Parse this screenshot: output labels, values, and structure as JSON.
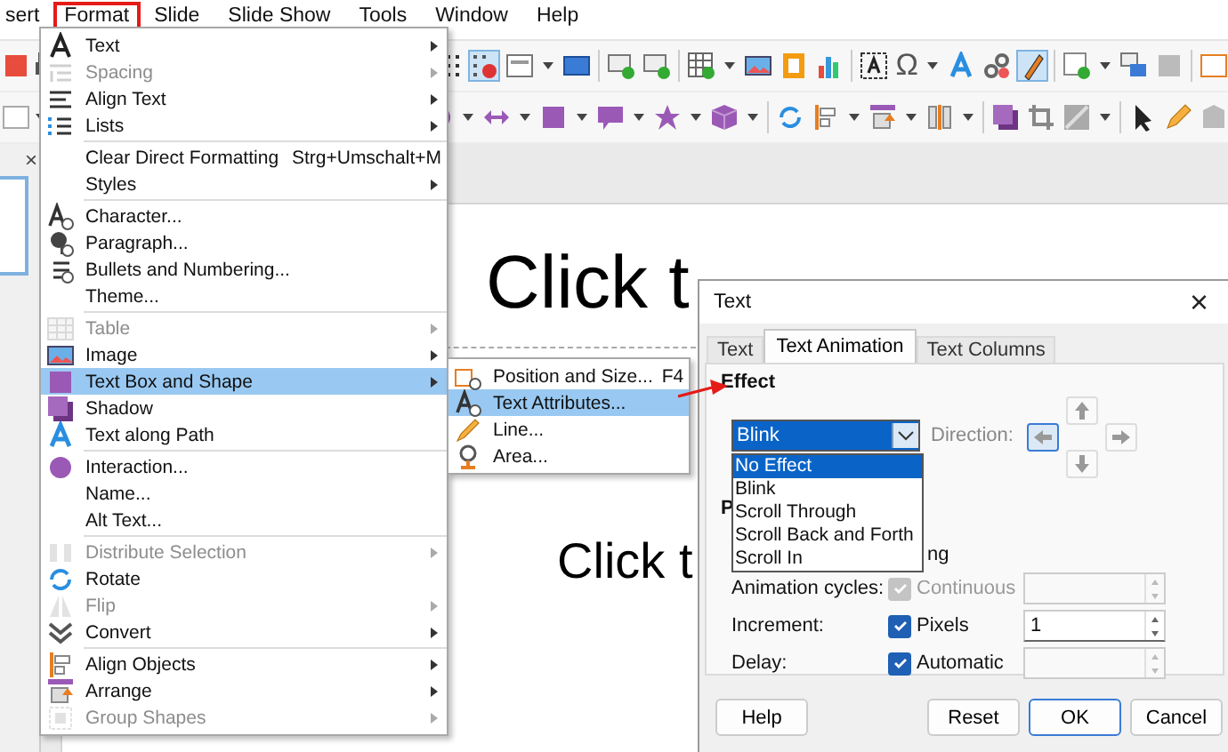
{
  "menubar": [
    {
      "label": "sert",
      "selected": false
    },
    {
      "label": "Format",
      "selected": true
    },
    {
      "label": "Slide",
      "selected": false
    },
    {
      "label": "Slide Show",
      "selected": false
    },
    {
      "label": "Tools",
      "selected": false
    },
    {
      "label": "Window",
      "selected": false
    },
    {
      "label": "Help",
      "selected": false
    }
  ],
  "toolbar_symbol": "Ω",
  "left_panel": {
    "close": "×"
  },
  "slide": {
    "title": "Click t",
    "subtitle": "Click t"
  },
  "format_menu": [
    {
      "kind": "item",
      "label": "Text",
      "submenu": true,
      "disabled": false,
      "selected": false
    },
    {
      "kind": "item",
      "label": "Spacing",
      "submenu": true,
      "disabled": true,
      "selected": false
    },
    {
      "kind": "item",
      "label": "Align Text",
      "submenu": true,
      "disabled": false,
      "selected": false
    },
    {
      "kind": "item",
      "label": "Lists",
      "submenu": true,
      "disabled": false,
      "selected": false
    },
    {
      "kind": "separator"
    },
    {
      "kind": "item",
      "label": "Clear Direct Formatting",
      "shortcut": "Strg+Umschalt+M",
      "submenu": false,
      "disabled": false,
      "selected": false
    },
    {
      "kind": "item",
      "label": "Styles",
      "submenu": true,
      "disabled": false,
      "selected": false
    },
    {
      "kind": "separator"
    },
    {
      "kind": "item",
      "label": "Character...",
      "submenu": false,
      "disabled": false,
      "selected": false
    },
    {
      "kind": "item",
      "label": "Paragraph...",
      "submenu": false,
      "disabled": false,
      "selected": false
    },
    {
      "kind": "item",
      "label": "Bullets and Numbering...",
      "submenu": false,
      "disabled": false,
      "selected": false
    },
    {
      "kind": "item",
      "label": "Theme...",
      "submenu": false,
      "disabled": false,
      "selected": false
    },
    {
      "kind": "separator"
    },
    {
      "kind": "item",
      "label": "Table",
      "submenu": true,
      "disabled": true,
      "selected": false
    },
    {
      "kind": "item",
      "label": "Image",
      "submenu": true,
      "disabled": false,
      "selected": false
    },
    {
      "kind": "item",
      "label": "Text Box and Shape",
      "submenu": true,
      "disabled": false,
      "selected": true
    },
    {
      "kind": "item",
      "label": "Shadow",
      "submenu": false,
      "disabled": false,
      "selected": false
    },
    {
      "kind": "item",
      "label": "Text along Path",
      "submenu": false,
      "disabled": false,
      "selected": false
    },
    {
      "kind": "separator"
    },
    {
      "kind": "item",
      "label": "Interaction...",
      "submenu": false,
      "disabled": false,
      "selected": false
    },
    {
      "kind": "item",
      "label": "Name...",
      "submenu": false,
      "disabled": false,
      "selected": false
    },
    {
      "kind": "item",
      "label": "Alt Text...",
      "submenu": false,
      "disabled": false,
      "selected": false
    },
    {
      "kind": "separator"
    },
    {
      "kind": "item",
      "label": "Distribute Selection",
      "submenu": true,
      "disabled": true,
      "selected": false
    },
    {
      "kind": "item",
      "label": "Rotate",
      "submenu": false,
      "disabled": false,
      "selected": false
    },
    {
      "kind": "item",
      "label": "Flip",
      "submenu": true,
      "disabled": true,
      "selected": false
    },
    {
      "kind": "item",
      "label": "Convert",
      "submenu": true,
      "disabled": false,
      "selected": false
    },
    {
      "kind": "separator"
    },
    {
      "kind": "item",
      "label": "Align Objects",
      "submenu": true,
      "disabled": false,
      "selected": false
    },
    {
      "kind": "item",
      "label": "Arrange",
      "submenu": true,
      "disabled": false,
      "selected": false
    },
    {
      "kind": "item",
      "label": "Group Shapes",
      "submenu": true,
      "disabled": true,
      "selected": false
    }
  ],
  "shape_submenu": [
    {
      "label": "Position and Size...",
      "shortcut": "F4",
      "selected": false
    },
    {
      "label": "Text Attributes...",
      "selected": true
    },
    {
      "label": "Line...",
      "selected": false
    },
    {
      "label": "Area...",
      "selected": false
    }
  ],
  "dialog": {
    "title": "Text",
    "close": "×",
    "tabs": [
      {
        "label": "Text",
        "selected": false
      },
      {
        "label": "Text Animation",
        "selected": true
      },
      {
        "label": "Text Columns",
        "selected": false
      }
    ],
    "effect_heading": "Effect",
    "effect_select": {
      "value": "Blink",
      "options": [
        {
          "label": "No Effect",
          "highlighted": true
        },
        {
          "label": "Blink",
          "highlighted": false
        },
        {
          "label": "Scroll Through",
          "highlighted": false
        },
        {
          "label": "Scroll Back and Forth",
          "highlighted": false
        },
        {
          "label": "Scroll In",
          "highlighted": false
        }
      ]
    },
    "direction_label": "Direction:",
    "direction_buttons": [
      {
        "kind": "up",
        "selected": false
      },
      {
        "kind": "left",
        "selected": true
      },
      {
        "kind": "right",
        "selected": false
      },
      {
        "kind": "down",
        "selected": false
      }
    ],
    "section_heading": "P",
    "partial_text": "ng",
    "rows": [
      {
        "label": "Animation cycles:",
        "checkbox": {
          "label": "Continuous",
          "checked": true,
          "disabled": true
        },
        "field": {
          "disabled": true
        }
      },
      {
        "label": "Increment:",
        "checkbox": {
          "label": "Pixels",
          "checked": true,
          "disabled": false
        },
        "field": {
          "value": "1",
          "disabled": false
        }
      },
      {
        "label": "Delay:",
        "checkbox": {
          "label": "Automatic",
          "checked": true,
          "disabled": false
        },
        "field": {
          "disabled": true
        }
      }
    ],
    "buttons": [
      {
        "label": "Help",
        "default": false
      },
      {
        "label": "Reset",
        "default": false
      },
      {
        "label": "OK",
        "default": true
      },
      {
        "label": "Cancel",
        "default": false
      }
    ]
  }
}
